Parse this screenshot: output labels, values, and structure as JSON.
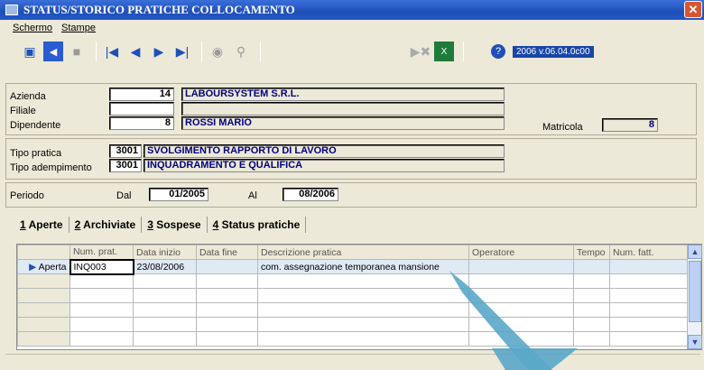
{
  "window": {
    "title": "STATUS/STORICO PRATICHE COLLOCAMENTO",
    "close": "✕"
  },
  "menu": [
    {
      "label": "Schermo"
    },
    {
      "label": "Stampe"
    }
  ],
  "toolbar": {
    "version": "2006 v.06.04.0c00"
  },
  "header": {
    "azienda_label": "Azienda",
    "azienda_code": "14",
    "azienda_name": "LABOURSYSTEM S.R.L.",
    "filiale_label": "Filiale",
    "filiale_code": "",
    "filiale_name": "",
    "dipendente_label": "Dipendente",
    "dipendente_code": "8",
    "dipendente_name": "ROSSI MARIO",
    "matricola_label": "Matricola",
    "matricola_value": "8"
  },
  "pratica": {
    "tipo_label": "Tipo pratica",
    "tipo_code": "3001",
    "tipo_desc": "SVOLGIMENTO RAPPORTO DI LAVORO",
    "adempimento_label": "Tipo adempimento",
    "adempimento_code": "3001",
    "adempimento_desc": "INQUADRAMENTO E QUALIFICA"
  },
  "periodo": {
    "label": "Periodo",
    "dal_label": "Dal",
    "dal_value": "01/2005",
    "al_label": "Al",
    "al_value": "08/2006"
  },
  "tabs": [
    {
      "key": "1",
      "label": " Aperte"
    },
    {
      "key": "2",
      "label": " Archiviate"
    },
    {
      "key": "3",
      "label": " Sospese"
    },
    {
      "key": "4",
      "label": " Status pratiche"
    }
  ],
  "grid": {
    "columns": [
      "Num. prat.",
      "Data inizio",
      "Data fine",
      "Descrizione pratica",
      "Operatore",
      "Tempo",
      "Num. fatt."
    ],
    "rows": [
      {
        "status": "Aperta",
        "num": "INQ003",
        "inizio": "23/08/2006",
        "fine": "",
        "descr": "com. assegnazione temporanea mansione",
        "operatore": "",
        "tempo": "",
        "fatt": ""
      }
    ]
  }
}
